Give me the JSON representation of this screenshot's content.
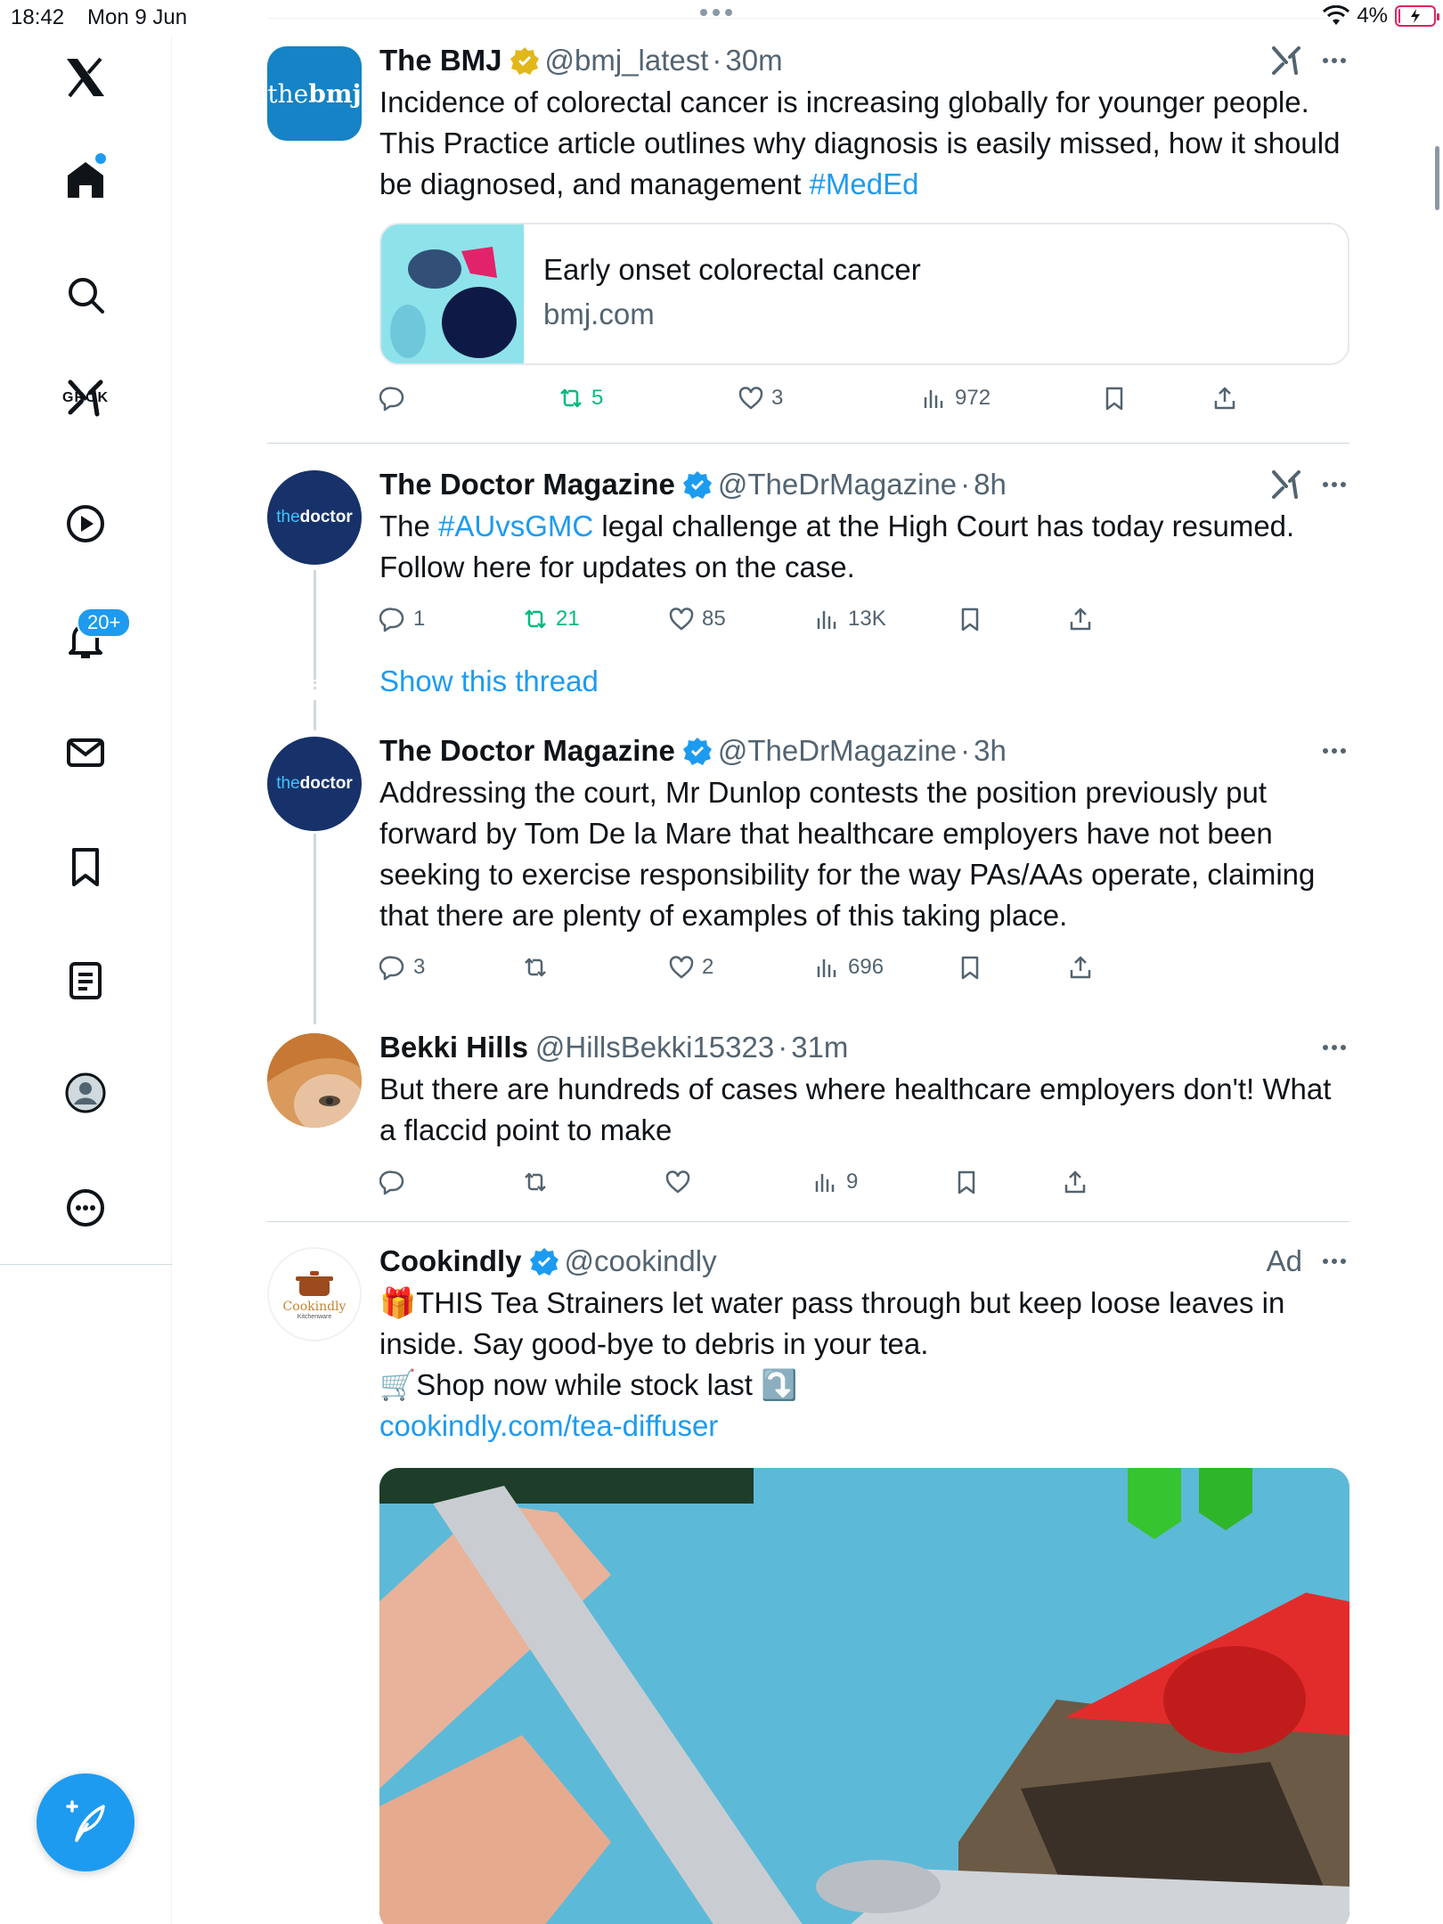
{
  "status_bar": {
    "time": "18:42",
    "date": "Mon 9 Jun",
    "battery_pct": "4%",
    "battery_level": 0.04
  },
  "sidebar": {
    "items": [
      {
        "icon": "x-logo-icon"
      },
      {
        "icon": "home-icon",
        "has_dot": true
      },
      {
        "icon": "search-icon"
      },
      {
        "icon": "grok-icon",
        "label": "GROK"
      },
      {
        "icon": "video-icon"
      },
      {
        "icon": "notifications-icon",
        "badge": "20+"
      },
      {
        "icon": "messages-icon"
      },
      {
        "icon": "bookmarks-icon"
      },
      {
        "icon": "lists-icon"
      },
      {
        "icon": "profile-icon"
      },
      {
        "icon": "more-icon"
      }
    ],
    "compose_icon": "compose-icon"
  },
  "colors": {
    "accent": "#1d9bf0",
    "retweet_green": "#00ba7c",
    "muted": "#536471",
    "verified_gold": "#e2b719",
    "bmj_blue": "#1583c5",
    "doctor_navy": "#17326a"
  },
  "posts": [
    {
      "avatar_text_a": "the",
      "avatar_text_b": "bmj",
      "name": "The BMJ",
      "verified": "gold",
      "handle": "@bmj_latest",
      "sep": "·",
      "time": "30m",
      "text": "Incidence of colorectal cancer is increasing globally for younger people. This Practice article outlines why diagnosis is easily missed, how it should be diagnosed, and management ",
      "hashtag": "#MedEd",
      "card": {
        "title": "Early onset colorectal cancer",
        "domain": "bmj.com"
      },
      "retweets": "5",
      "likes": "3",
      "views": "972"
    },
    {
      "avatar_text_a": "the",
      "avatar_text_b": "doctor",
      "name": "The Doctor Magazine",
      "verified": "blue",
      "handle": "@TheDrMagazine",
      "sep": "·",
      "time": "8h",
      "text_pre": "The ",
      "hashtag": "#AUvsGMC",
      "text_post": " legal challenge at the High Court has today resumed. Follow here for updates on the case.",
      "replies": "1",
      "retweets": "21",
      "likes": "85",
      "views": "13K",
      "show_thread": "Show this thread"
    },
    {
      "avatar_text_a": "the",
      "avatar_text_b": "doctor",
      "name": "The Doctor Magazine",
      "verified": "blue",
      "handle": "@TheDrMagazine",
      "sep": "·",
      "time": "3h",
      "text": "Addressing the court, Mr Dunlop contests the position previously put forward by Tom De la Mare that healthcare employers have not been seeking to exercise responsibility for the way PAs/AAs operate, claiming that there are plenty of examples of this taking place.",
      "replies": "3",
      "likes": "2",
      "views": "696"
    },
    {
      "name": "Bekki Hills",
      "handle": "@HillsBekki15323",
      "sep": "·",
      "time": "31m",
      "text": "But there are hundreds of cases where healthcare employers don't! What a flaccid point to make",
      "views": "9"
    },
    {
      "avatar_text": "Cookindly",
      "avatar_sub": "Kitchenware",
      "name": "Cookindly",
      "verified": "blue",
      "handle": "@cookindly",
      "ad_label": "Ad",
      "line1": "🎁THIS Tea Strainers let water pass through but keep loose leaves in inside. Say good-bye to debris in your tea.",
      "line2": "🛒Shop now while stock last ⤵️",
      "link": "cookindly.com/tea-diffuser"
    }
  ]
}
